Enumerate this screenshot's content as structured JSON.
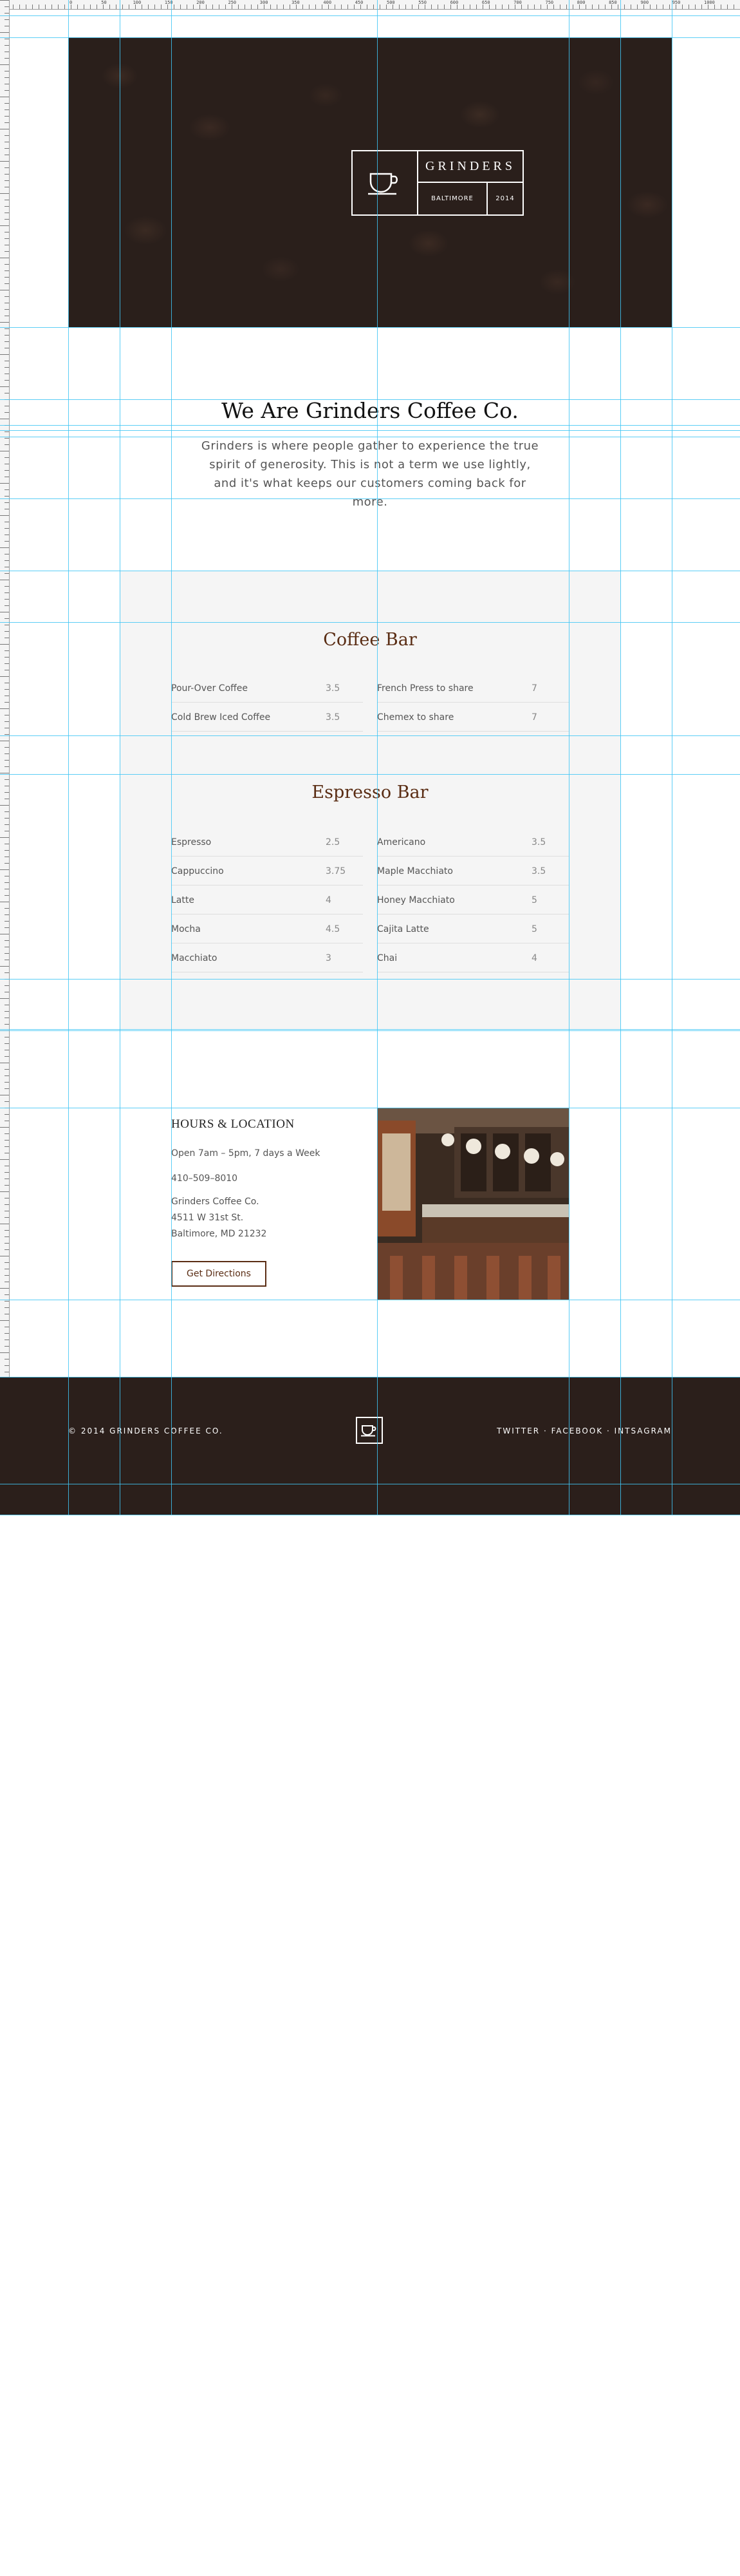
{
  "ruler": {
    "labels": [
      "0",
      "50",
      "100",
      "150",
      "200",
      "250",
      "300",
      "350",
      "400",
      "450",
      "500",
      "550",
      "600",
      "650",
      "700",
      "750",
      "800",
      "850",
      "900",
      "950",
      "1000"
    ]
  },
  "hero": {
    "brand_name": "GRINDERS",
    "city": "BALTIMORE",
    "year": "2014",
    "icon": "coffee-cup-icon"
  },
  "intro": {
    "title": "We Are Grinders Coffee Co.",
    "text": "Grinders is where people gather to experience the true spirit of generosity. This is not a term we use lightly, and it's what keeps our customers coming back for more."
  },
  "coffee_bar": {
    "title": "Coffee Bar",
    "left_items": [
      {
        "name": "Pour-Over Coffee",
        "price": "3.5"
      },
      {
        "name": "Cold Brew Iced Coffee",
        "price": "3.5"
      }
    ],
    "right_items": [
      {
        "name": "French Press to share",
        "price": "7"
      },
      {
        "name": "Chemex to share",
        "price": "7"
      }
    ]
  },
  "espresso_bar": {
    "title": "Espresso Bar",
    "left_items": [
      {
        "name": "Espresso",
        "price": "2.5"
      },
      {
        "name": "Cappuccino",
        "price": "3.75"
      },
      {
        "name": "Latte",
        "price": "4"
      },
      {
        "name": "Mocha",
        "price": "4.5"
      },
      {
        "name": "Macchiato",
        "price": "3"
      }
    ],
    "right_items": [
      {
        "name": "Americano",
        "price": "3.5"
      },
      {
        "name": "Maple Macchiato",
        "price": "3.5"
      },
      {
        "name": "Honey Macchiato",
        "price": "5"
      },
      {
        "name": "Cajita Latte",
        "price": "5"
      },
      {
        "name": "Chai",
        "price": "4"
      }
    ]
  },
  "hours": {
    "title": "HOURS & LOCATION",
    "schedule": "Open 7am – 5pm, 7 days a Week",
    "phone": "410–509–8010",
    "business": "Grinders Coffee Co.",
    "street": "4511 W 31st St.",
    "city": "Baltimore, MD 21232",
    "button": "Get Directions"
  },
  "footer": {
    "copyright": "© 2014 GRINDERS COFFEE CO.",
    "twitter": "TWITTER",
    "facebook": "FACEBOOK",
    "instagram": "INTSAGRAM",
    "separator": " · ",
    "icon": "coffee-cup-icon"
  },
  "colors": {
    "accent": "#5a2d14",
    "hero_bg": "#2a1f1b",
    "footer_bg": "#2b1f1b",
    "guide": "#3fc6f5",
    "panel_bg": "#f5f5f5"
  }
}
